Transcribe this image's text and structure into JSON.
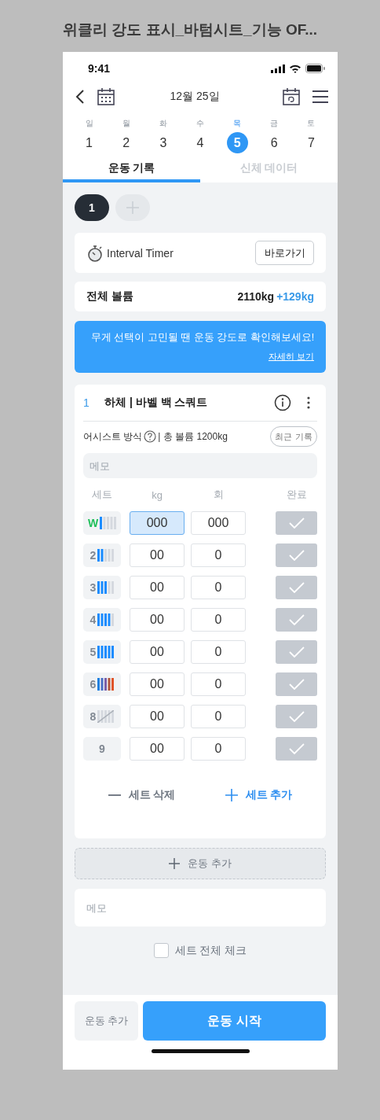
{
  "page_title": "위클리 강도 표시_바텀시트_기능 OF...",
  "status_bar": {
    "time": "9:41"
  },
  "nav": {
    "date": "12월 25일"
  },
  "week": [
    {
      "weekday": "일",
      "date": "1",
      "selected": false
    },
    {
      "weekday": "월",
      "date": "2",
      "selected": false
    },
    {
      "weekday": "화",
      "date": "3",
      "selected": false
    },
    {
      "weekday": "수",
      "date": "4",
      "selected": false
    },
    {
      "weekday": "목",
      "date": "5",
      "selected": true
    },
    {
      "weekday": "금",
      "date": "6",
      "selected": false
    },
    {
      "weekday": "토",
      "date": "7",
      "selected": false
    }
  ],
  "tabs": [
    {
      "label": "운동 기록",
      "selected": true
    },
    {
      "label": "신체 데이터",
      "selected": false
    }
  ],
  "sessions": [
    {
      "label": "1",
      "selected": true
    }
  ],
  "interval_timer": {
    "label": "Interval Timer",
    "button": "바로가기"
  },
  "total_volume": {
    "label": "전체 볼륨",
    "value": "2110kg",
    "change": "+129kg"
  },
  "banner": {
    "text": "무게 선택이 고민될 땐 운동 강도로 확인해보세요!",
    "link": "자세히 보기"
  },
  "exercise": {
    "number": "1",
    "title": "하체 | 바벨 백 스쿼트",
    "method": "어시스트 방식",
    "volume": "| 총 볼륨 1200kg",
    "recent_button": "최근 기록",
    "memo_placeholder": "메모",
    "columns": [
      "세트",
      "kg",
      "회",
      "완료"
    ],
    "sets": [
      {
        "label": "W",
        "warmup": true,
        "kind": "one",
        "kg": "000",
        "reps": "000",
        "focused": true,
        "done": false
      },
      {
        "label": "2",
        "warmup": false,
        "kind": "two",
        "kg": "00",
        "reps": "0",
        "focused": false,
        "done": false
      },
      {
        "label": "3",
        "warmup": false,
        "kind": "three",
        "kg": "00",
        "reps": "0",
        "focused": false,
        "done": false
      },
      {
        "label": "4",
        "warmup": false,
        "kind": "four",
        "kg": "00",
        "reps": "0",
        "focused": false,
        "done": false
      },
      {
        "label": "5",
        "warmup": false,
        "kind": "five",
        "kg": "00",
        "reps": "0",
        "focused": false,
        "done": false
      },
      {
        "label": "6",
        "warmup": false,
        "kind": "max",
        "kg": "00",
        "reps": "0",
        "focused": false,
        "done": false
      },
      {
        "label": "8",
        "warmup": false,
        "kind": "skipped",
        "kg": "00",
        "reps": "0",
        "focused": false,
        "done": false
      },
      {
        "label": "9",
        "warmup": false,
        "kind": "none",
        "kg": "00",
        "reps": "0",
        "focused": false,
        "done": false
      }
    ],
    "delete_set": "세트 삭제",
    "add_set": "세트 추가"
  },
  "add_exercise": "운동 추가",
  "memo_placeholder": "메모",
  "check_all": {
    "label": "세트 전체 체크",
    "checked": false
  },
  "bottom": {
    "secondary": "운동 추가",
    "primary": "운동 시작"
  }
}
